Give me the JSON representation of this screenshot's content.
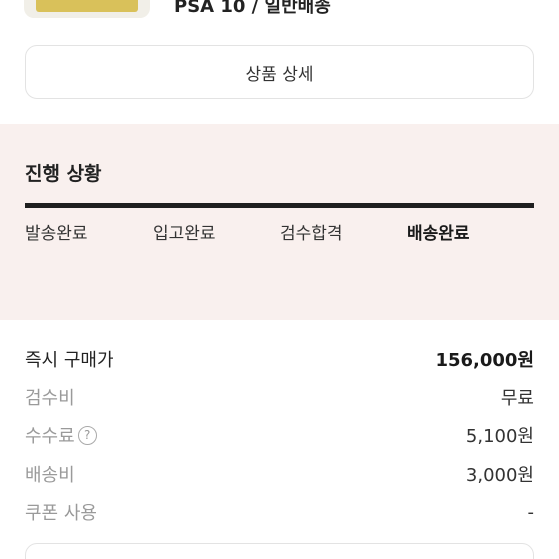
{
  "product": {
    "name": "PSA 10 / 일반배송"
  },
  "detail_button": {
    "label": "상품 상세"
  },
  "progress": {
    "title": "진행 상황",
    "steps": [
      "발송완료",
      "입고완료",
      "검수합격",
      "배송완료"
    ],
    "current_step": "배송완료"
  },
  "price": {
    "instant_buy": {
      "label": "즉시 구매가",
      "value": "156,000원"
    },
    "inspection_fee": {
      "label": "검수비",
      "value": "무료"
    },
    "commission": {
      "label": "수수료",
      "value": "5,100원"
    },
    "shipping_fee": {
      "label": "배송비",
      "value": "3,000원"
    },
    "coupon": {
      "label": "쿠폰 사용",
      "value": "-"
    }
  },
  "colors": {
    "progress_background": "#f9f0ee",
    "progress_bar": "#1f1f1f"
  },
  "icons": {
    "commission_help": "question-circle-icon"
  }
}
